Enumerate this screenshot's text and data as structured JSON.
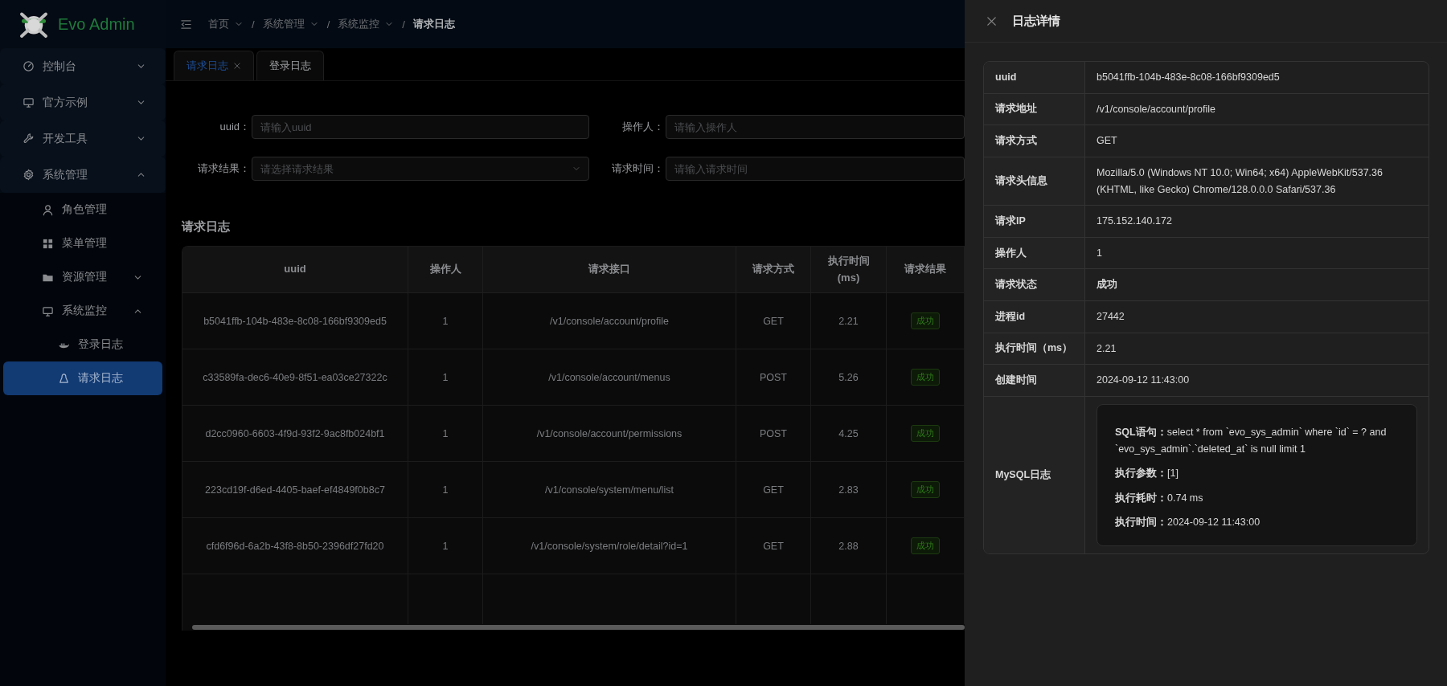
{
  "app": {
    "title": "Evo Admin"
  },
  "sidebar": {
    "items": [
      {
        "label": "控制台",
        "expanded": false,
        "selected": false
      },
      {
        "label": "官方示例",
        "expanded": false,
        "selected": false
      },
      {
        "label": "开发工具",
        "expanded": false,
        "selected": false
      },
      {
        "label": "系统管理",
        "expanded": true,
        "selected": false,
        "children": [
          {
            "label": "角色管理",
            "selected": false
          },
          {
            "label": "菜单管理",
            "selected": false
          },
          {
            "label": "资源管理",
            "expanded": false,
            "selected": false
          },
          {
            "label": "系统监控",
            "expanded": true,
            "selected": false,
            "children": [
              {
                "label": "登录日志",
                "selected": false
              },
              {
                "label": "请求日志",
                "selected": true
              }
            ]
          }
        ]
      }
    ]
  },
  "breadcrumb_separator": "/",
  "breadcrumb": [
    {
      "label": "首页",
      "dropdown": true
    },
    {
      "label": "系统管理",
      "dropdown": true
    },
    {
      "label": "系统监控",
      "dropdown": true
    },
    {
      "label": "请求日志",
      "dropdown": false
    }
  ],
  "tabs": [
    {
      "label": "请求日志",
      "selected": true,
      "closable": true
    },
    {
      "label": "登录日志",
      "selected": false,
      "closable": false
    }
  ],
  "filters": [
    {
      "label": "uuid：",
      "placeholder": "请输入uuid",
      "kind": "text"
    },
    {
      "label": "操作人：",
      "placeholder": "请输入操作人",
      "kind": "text"
    },
    {
      "label": "请求结果：",
      "placeholder": "请选择请求结果",
      "kind": "select"
    },
    {
      "label": "请求时间：",
      "placeholder": "请输入请求时间",
      "kind": "text"
    }
  ],
  "table": {
    "title": "请求日志",
    "columns": [
      "uuid",
      "操作人",
      "请求接口",
      "请求方式",
      "执行时间 (ms)",
      "请求结果"
    ],
    "rows": [
      {
        "uuid": "b5041ffb-104b-483e-8c08-166bf9309ed5",
        "operator": "1",
        "path": "/v1/console/account/profile",
        "method": "GET",
        "duration": "2.21",
        "result": {
          "label": "成功",
          "kind": "success"
        }
      },
      {
        "uuid": "c33589fa-dec6-40e9-8f51-ea03ce27322c",
        "operator": "1",
        "path": "/v1/console/account/menus",
        "method": "POST",
        "duration": "5.26",
        "result": {
          "label": "成功",
          "kind": "success"
        }
      },
      {
        "uuid": "d2cc0960-6603-4f9d-93f2-9ac8fb024bf1",
        "operator": "1",
        "path": "/v1/console/account/permissions",
        "method": "POST",
        "duration": "4.25",
        "result": {
          "label": "成功",
          "kind": "success"
        }
      },
      {
        "uuid": "223cd19f-d6ed-4405-baef-ef4849f0b8c7",
        "operator": "1",
        "path": "/v1/console/system/menu/list",
        "method": "GET",
        "duration": "2.83",
        "result": {
          "label": "成功",
          "kind": "success"
        }
      },
      {
        "uuid": "cfd6f96d-6a2b-43f8-8b50-2396df27fd20",
        "operator": "1",
        "path": "/v1/console/system/role/detail?id=1",
        "method": "GET",
        "duration": "2.88",
        "result": {
          "label": "成功",
          "kind": "success"
        }
      }
    ]
  },
  "drawer": {
    "title": "日志详情",
    "details": [
      {
        "label": "uuid",
        "kind": "text",
        "value": "b5041ffb-104b-483e-8c08-166bf9309ed5"
      },
      {
        "label": "请求地址",
        "kind": "text",
        "value": "/v1/console/account/profile"
      },
      {
        "label": "请求方式",
        "kind": "text",
        "value": "GET"
      },
      {
        "label": "请求头信息",
        "kind": "text",
        "value": "Mozilla/5.0 (Windows NT 10.0; Win64; x64) AppleWebKit/537.36 (KHTML, like Gecko) Chrome/128.0.0.0 Safari/537.36"
      },
      {
        "label": "请求IP",
        "kind": "text",
        "value": "175.152.140.172"
      },
      {
        "label": "操作人",
        "kind": "text",
        "value": "1"
      },
      {
        "label": "请求状态",
        "kind": "status",
        "value": "成功"
      },
      {
        "label": "进程id",
        "kind": "text",
        "value": "27442"
      },
      {
        "label": "执行时间（ms）",
        "kind": "text",
        "value": "2.21"
      },
      {
        "label": "创建时间",
        "kind": "text",
        "value": "2024-09-12 11:43:00"
      },
      {
        "label": "MySQL日志",
        "kind": "log",
        "lines": [
          "**SQL语句：**select * from `evo_sys_admin` where `id` = ? and `evo_sys_admin`.`deleted_at` is null limit 1",
          "**执行参数：**[1]",
          "**执行耗时：**0.74 ms",
          "**执行时间：**2024-09-12 11:43:00"
        ]
      }
    ]
  }
}
